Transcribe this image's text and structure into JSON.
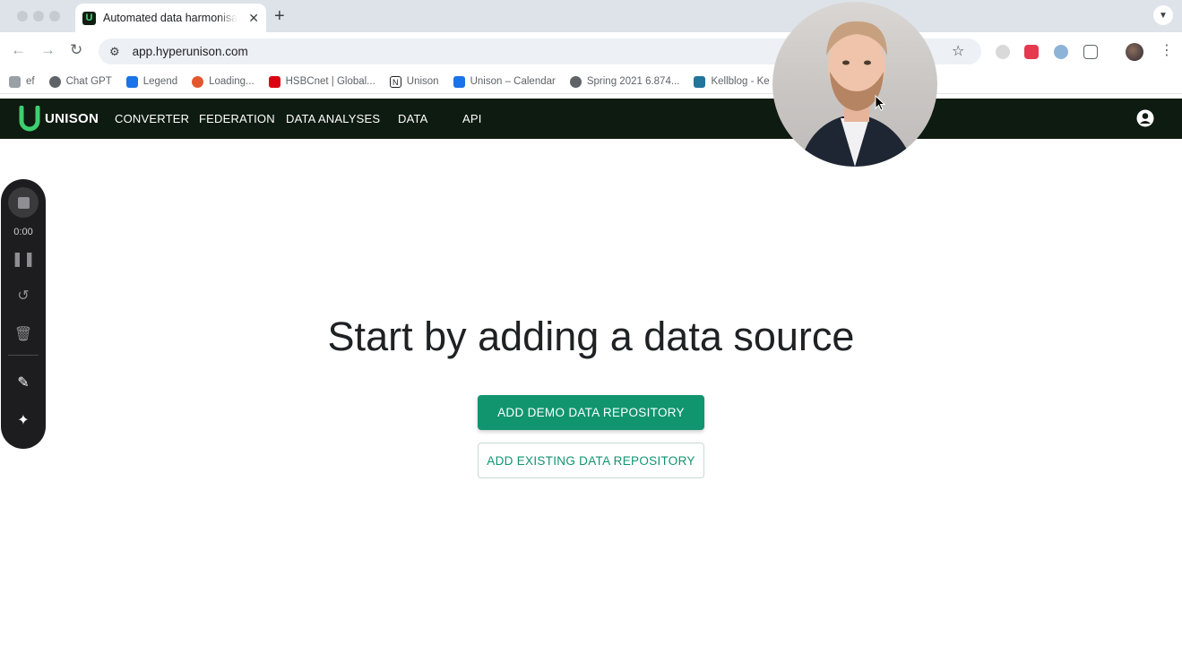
{
  "browser": {
    "tab_title": "Automated data harmonisation",
    "favicon_letter": "U",
    "tab_close": "✕",
    "new_tab": "+",
    "url": "app.hyperunison.com",
    "bookmarks": [
      {
        "label": "ef",
        "icon": "key-icon",
        "color": "#9aa0a6"
      },
      {
        "label": "Chat GPT",
        "icon": "openai-icon",
        "color": "#5f6368"
      },
      {
        "label": "Legend",
        "icon": "legend-icon",
        "color": "#1a73e8"
      },
      {
        "label": "Loading...",
        "icon": "hubspot-icon",
        "color": "#e4572e"
      },
      {
        "label": "HSBCnet | Global...",
        "icon": "hsbc-icon",
        "color": "#db0011"
      },
      {
        "label": "Unison",
        "icon": "notion-icon",
        "color": "#202124"
      },
      {
        "label": "Unison – Calendar",
        "icon": "calendar-icon",
        "color": "#1a73e8"
      },
      {
        "label": "Spring 2021 6.874...",
        "icon": "globe-icon",
        "color": "#5f6368"
      },
      {
        "label": "Kellblog - Ke",
        "icon": "wordpress-icon",
        "color": "#21759b"
      }
    ]
  },
  "app": {
    "brand": "UNISON",
    "nav": [
      "CONVERTER",
      "FEDERATION",
      "DATA ANALYSES",
      "DATA",
      "API"
    ],
    "accent": "#11956f",
    "nav_bg": "#0e1b10"
  },
  "main": {
    "headline": "Start by adding a data source",
    "primary_button": "ADD DEMO DATA REPOSITORY",
    "secondary_button": "ADD EXISTING DATA REPOSITORY"
  },
  "recorder": {
    "time": "0:00"
  }
}
